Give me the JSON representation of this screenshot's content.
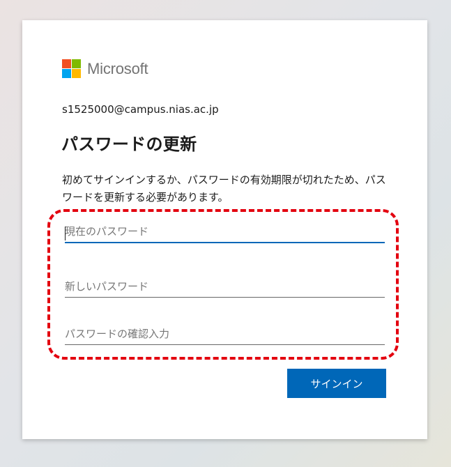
{
  "brand": {
    "name": "Microsoft",
    "logo_colors": [
      "#f25022",
      "#7fba00",
      "#00a4ef",
      "#ffb900"
    ]
  },
  "account": {
    "email": "s1525000@campus.nias.ac.jp"
  },
  "page": {
    "title": "パスワードの更新",
    "description": "初めてサインインするか、パスワードの有効期限が切れたため、パスワードを更新する必要があります。"
  },
  "form": {
    "current_password": {
      "placeholder": "現在のパスワード",
      "value": ""
    },
    "new_password": {
      "placeholder": "新しいパスワード",
      "value": ""
    },
    "confirm_password": {
      "placeholder": "パスワードの確認入力",
      "value": ""
    },
    "submit_label": "サインイン"
  },
  "annotation": {
    "highlight_color": "#e3000f"
  },
  "colors": {
    "accent": "#0067b8"
  }
}
